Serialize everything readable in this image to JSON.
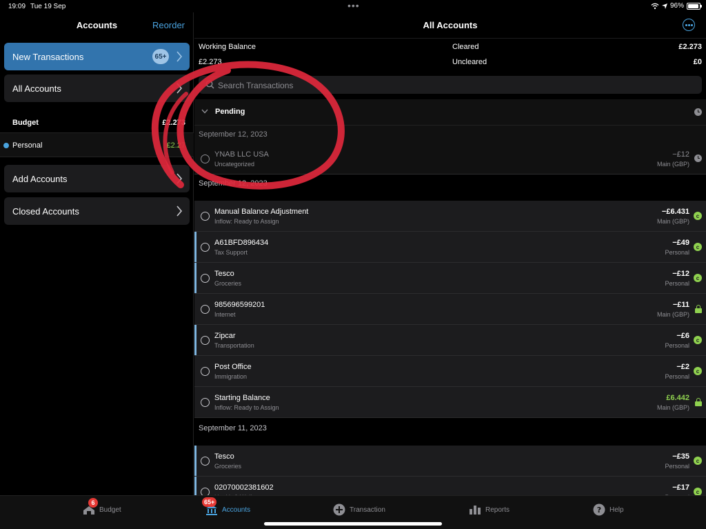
{
  "status_bar": {
    "time": "19:09",
    "date": "Tue 19 Sep",
    "battery": "96%"
  },
  "sidebar": {
    "title": "Accounts",
    "reorder_label": "Reorder",
    "new_transactions": {
      "label": "New Transactions",
      "count": "65+"
    },
    "all_accounts_label": "All Accounts",
    "budget": {
      "label": "Budget",
      "amount": "£2.273"
    },
    "personal": {
      "label": "Personal",
      "amount": "£2.27"
    },
    "add_accounts_label": "Add Accounts",
    "closed_accounts_label": "Closed Accounts"
  },
  "main": {
    "title": "All Accounts",
    "working_balance_label": "Working Balance",
    "working_balance_value": "£2.273",
    "cleared_label": "Cleared",
    "cleared_value": "£2.273",
    "uncleared_label": "Uncleared",
    "uncleared_value": "£0",
    "search_placeholder": "Search Transactions",
    "pending_label": "Pending",
    "pending_group": {
      "date": "September 12, 2023",
      "rows": [
        {
          "payee": "YNAB LLC USA",
          "category": "Uncategorized",
          "amount": "−£12",
          "account": "Main (GBP)"
        }
      ]
    },
    "groups": [
      {
        "date": "September 12, 2023",
        "rows": [
          {
            "payee": "Manual Balance Adjustment",
            "category": "Inflow: Ready to Assign",
            "amount": "−£6.431",
            "account": "Main (GBP)",
            "status": "cleared",
            "marked": false
          },
          {
            "payee": "A61BFD896434",
            "category": "Tax Support",
            "amount": "−£49",
            "account": "Personal",
            "status": "cleared",
            "marked": true
          },
          {
            "payee": "Tesco",
            "category": "Groceries",
            "amount": "−£12",
            "account": "Personal",
            "status": "cleared",
            "marked": true
          },
          {
            "payee": "985696599201",
            "category": "Internet",
            "amount": "−£11",
            "account": "Main (GBP)",
            "status": "locked",
            "marked": false
          },
          {
            "payee": "Zipcar",
            "category": "Transportation",
            "amount": "−£6",
            "account": "Personal",
            "status": "cleared",
            "marked": true
          },
          {
            "payee": "Post Office",
            "category": "Immigration",
            "amount": "−£2",
            "account": "Personal",
            "status": "cleared",
            "marked": false
          },
          {
            "payee": "Starting Balance",
            "category": "Inflow: Ready to Assign",
            "amount": "£6.442",
            "account": "Main (GBP)",
            "status": "locked",
            "marked": false,
            "positive": true
          }
        ]
      },
      {
        "date": "September 11, 2023",
        "rows": [
          {
            "payee": "Tesco",
            "category": "Groceries",
            "amount": "−£35",
            "account": "Personal",
            "status": "cleared",
            "marked": true
          },
          {
            "payee": "02070002381602",
            "category": "Health & Wellness",
            "amount": "−£17",
            "account": "Personal",
            "status": "cleared",
            "marked": true
          }
        ]
      }
    ]
  },
  "tabs": {
    "budget": {
      "label": "Budget",
      "badge": "6"
    },
    "accounts": {
      "label": "Accounts",
      "badge": "65+"
    },
    "transaction": {
      "label": "Transaction"
    },
    "reports": {
      "label": "Reports"
    },
    "help": {
      "label": "Help"
    }
  },
  "colors": {
    "accent": "#4aa3df",
    "positive": "#8fd14f",
    "annotation": "#e0283c",
    "new_tx_bg": "#3274ad"
  },
  "icons": [
    "wifi-icon",
    "battery-icon",
    "chevron-right-icon",
    "more-icon",
    "search-icon",
    "chevron-down-icon",
    "clock-icon",
    "cleared-icon",
    "lock-icon",
    "budget-tab-icon",
    "accounts-tab-icon",
    "add-transaction-icon",
    "reports-icon",
    "help-icon"
  ]
}
